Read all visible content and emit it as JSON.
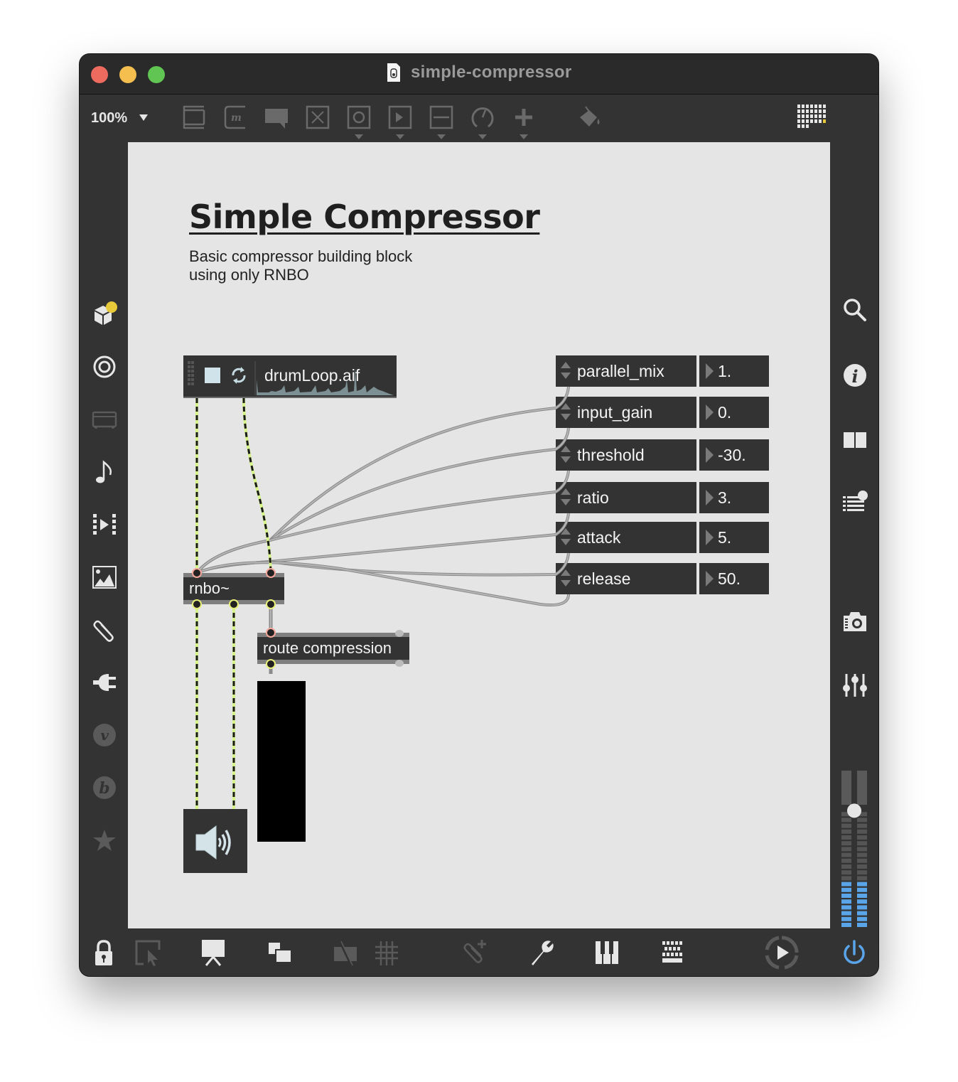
{
  "window": {
    "title": "simple-compressor",
    "traffic_lights": [
      "close",
      "minimize",
      "zoom"
    ]
  },
  "toolbar": {
    "zoom_level": "100%",
    "icons": [
      "new-object-icon",
      "message-box-icon",
      "comment-icon",
      "toggle-icon",
      "button-icon",
      "playbar-icon",
      "slider-icon",
      "dial-icon",
      "add-icon",
      "paint-bucket-icon",
      "grid-presentation-icon"
    ]
  },
  "left_sidebar": {
    "icons": [
      "package-manager-icon",
      "audio-icon",
      "video-icon",
      "music-note-icon",
      "media-player-icon",
      "image-icon",
      "attachment-icon",
      "plugin-icon",
      "v-badge-icon",
      "b-badge-icon",
      "favorites-star-icon"
    ]
  },
  "right_sidebar": {
    "icons": [
      "search-icon",
      "info-icon",
      "split-view-icon",
      "console-list-icon",
      "snapshot-camera-icon",
      "mixer-sliders-icon"
    ],
    "volume_slider_level": 0.78,
    "meter_level_left": 0.35,
    "meter_level_right": 0.35
  },
  "bottom_bar": {
    "icons": [
      "lock-icon",
      "presentation-select-icon",
      "presentation-easel-icon",
      "new-view-icon",
      "hide-icon",
      "grid-icon",
      "attach-file-icon",
      "wrench-icon",
      "keyboard-piano-icon",
      "computer-keyboard-icon",
      "transport-play-icon",
      "audio-power-icon"
    ]
  },
  "patch": {
    "title": "Simple Compressor",
    "description_line1": "Basic compressor building block",
    "description_line2": "using only RNBO",
    "player": {
      "filename": "drumLoop.aif"
    },
    "rnbo_object": "rnbo~",
    "route_object": "route compression",
    "params": [
      {
        "name": "parallel_mix",
        "value": "1."
      },
      {
        "name": "input_gain",
        "value": "0."
      },
      {
        "name": "threshold",
        "value": "-30."
      },
      {
        "name": "ratio",
        "value": "3."
      },
      {
        "name": "attack",
        "value": "5."
      },
      {
        "name": "release",
        "value": "50."
      }
    ]
  },
  "colors": {
    "canvas_bg": "#e5e5e5",
    "object_bg": "#333333",
    "signal_cord": "#d6f48a",
    "meter_blue": "#5aa5ea",
    "accent_yellow": "#e8c93a"
  }
}
